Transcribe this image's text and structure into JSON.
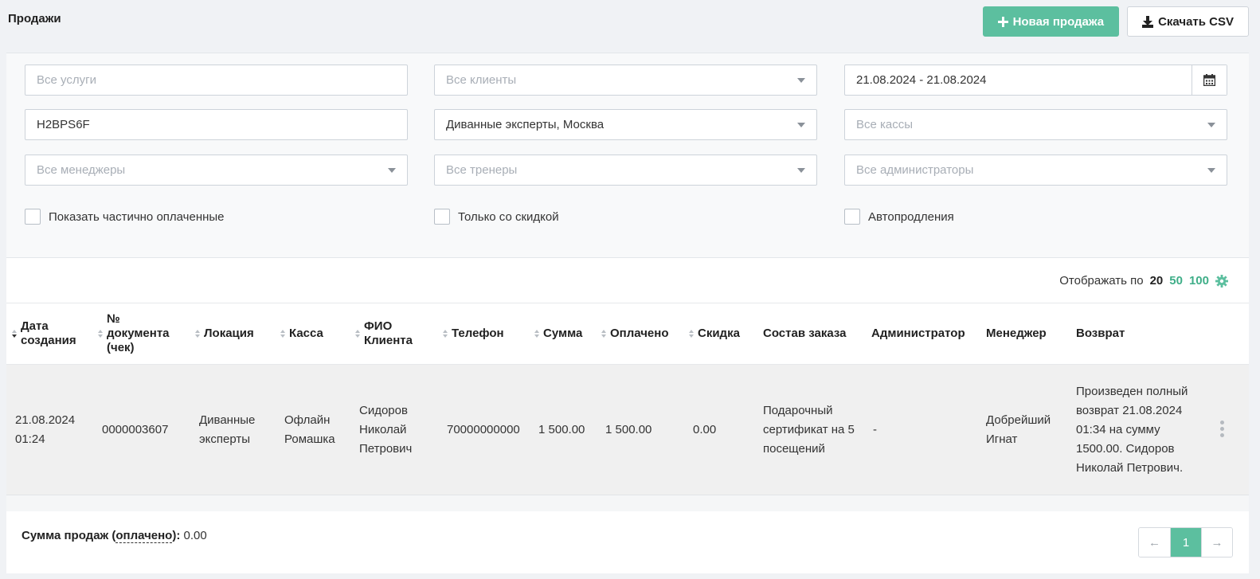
{
  "page": {
    "title": "Продажи"
  },
  "actions": {
    "new_sale": "Новая продажа",
    "download_csv": "Скачать CSV"
  },
  "filters": {
    "services": {
      "placeholder": "Все услуги",
      "value": ""
    },
    "clients": {
      "placeholder": "Все клиенты"
    },
    "date_range": {
      "value": "21.08.2024 - 21.08.2024"
    },
    "code": {
      "value": "H2BPS6F"
    },
    "location": {
      "value": "Диванные эксперты, Москва"
    },
    "cashbox": {
      "placeholder": "Все кассы"
    },
    "managers": {
      "placeholder": "Все менеджеры"
    },
    "trainers": {
      "placeholder": "Все тренеры"
    },
    "admins": {
      "placeholder": "Все администраторы"
    },
    "checkboxes": {
      "partial": "Показать частично оплаченные",
      "discount": "Только со скидкой",
      "autorenew": "Автопродления"
    }
  },
  "per_page": {
    "label": "Отображать по",
    "current": "20",
    "options": [
      "50",
      "100"
    ]
  },
  "table": {
    "columns": {
      "created": "Дата создания",
      "doc": "№ документа (чек)",
      "location": "Локация",
      "cashbox": "Касса",
      "client": "ФИО Клиента",
      "phone": "Телефон",
      "sum": "Сумма",
      "paid": "Оплачено",
      "discount": "Скидка",
      "order": "Состав заказа",
      "admin": "Администратор",
      "manager": "Менеджер",
      "refund": "Возврат"
    },
    "rows": [
      {
        "created": "21.08.2024 01:24",
        "doc": "0000003607",
        "location": "Диванные эксперты",
        "cashbox": "Офлайн Ромашка",
        "client": "Сидоров Николай Петрович",
        "phone": "70000000000",
        "sum": "1 500.00",
        "paid": "1 500.00",
        "discount": "0.00",
        "order": "Подарочный сертификат на 5 посещений",
        "admin": "-",
        "manager": "Добрейший Игнат",
        "refund": "Произведен полный возврат 21.08.2024 01:34 на сумму 1500.00. Сидоров Николай Петрович."
      }
    ]
  },
  "summary": {
    "label_prefix": "Сумма продаж (",
    "label_link": "оплачено",
    "label_suffix": "):",
    "value": "0.00"
  },
  "pagination": {
    "prev": "←",
    "current": "1",
    "next": "→"
  },
  "colors": {
    "accent": "#5cbf9f",
    "link": "#3fae88"
  }
}
